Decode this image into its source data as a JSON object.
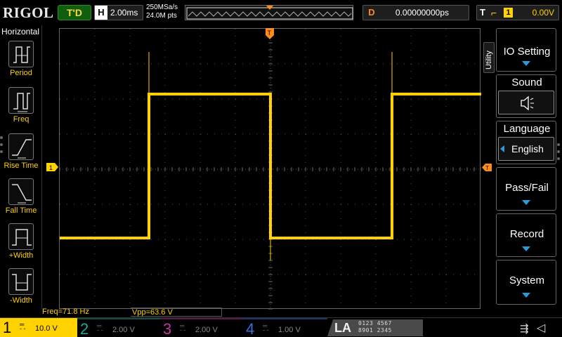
{
  "brand": "RIGOL",
  "topbar": {
    "trigger_status": "T'D",
    "horizontal_label": "H",
    "timebase": "2.00ms",
    "sample_rate": "250MSa/s",
    "memory_depth": "24.0M pts",
    "delay_label": "D",
    "delay_value": "0.00000000ps",
    "trigger_label": "T",
    "trigger_source": "1",
    "trigger_level": "0.00V"
  },
  "left_menu": {
    "title": "Horizontal",
    "items": [
      {
        "label": "Period",
        "icon": "period-icon"
      },
      {
        "label": "Freq",
        "icon": "freq-icon"
      },
      {
        "label": "Rise Time",
        "icon": "rise-time-icon"
      },
      {
        "label": "Fall Time",
        "icon": "fall-time-icon"
      },
      {
        "label": "+Width",
        "icon": "pos-width-icon"
      },
      {
        "label": "-Width",
        "icon": "neg-width-icon"
      }
    ]
  },
  "right_menu": {
    "tab": "Utility",
    "items": [
      {
        "label": "IO Setting"
      },
      {
        "label": "Sound",
        "value_icon": "speaker-icon"
      },
      {
        "label": "Language",
        "value": "English"
      },
      {
        "label": "Pass/Fail"
      },
      {
        "label": "Record"
      },
      {
        "label": "System"
      }
    ]
  },
  "measurements": {
    "freq": "Freq=71.8 Hz",
    "vpp": "Vpp=63.6 V"
  },
  "channels": [
    {
      "num": "1",
      "scale": "10.0 V",
      "color": "#ffd200",
      "active": true
    },
    {
      "num": "2",
      "scale": "2.00 V",
      "color": "#1aa89a",
      "active": false
    },
    {
      "num": "3",
      "scale": "2.00 V",
      "color": "#c0379a",
      "active": false
    },
    {
      "num": "4",
      "scale": "1.00 V",
      "color": "#3a6fd8",
      "active": false
    }
  ],
  "la": {
    "label": "LA",
    "bits_row1": "0123 4567",
    "bits_row2": "8901 2345"
  },
  "markers": {
    "trigger_position": "T",
    "ground_marker": "1"
  },
  "waveform": {
    "channel": "1",
    "shape": "square",
    "levels": [
      "low",
      "high",
      "low",
      "high"
    ]
  },
  "colors": {
    "trace": "#ffd200",
    "accent_orange": "#ff8c1a",
    "menu_arrow": "#2a9ad8"
  }
}
